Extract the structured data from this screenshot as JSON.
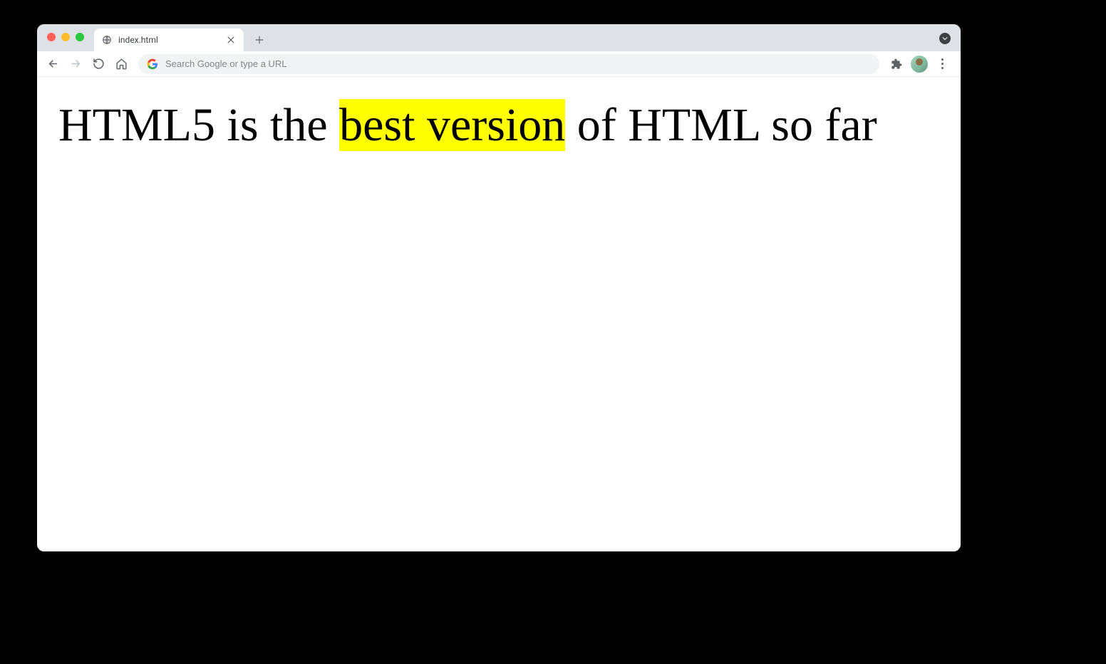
{
  "browser": {
    "tab": {
      "title": "index.html"
    },
    "omnibox": {
      "placeholder": "Search Google or type a URL"
    }
  },
  "page": {
    "heading": {
      "before": "HTML5 is the ",
      "highlight": "best version",
      "after": " of HTML so far"
    }
  }
}
